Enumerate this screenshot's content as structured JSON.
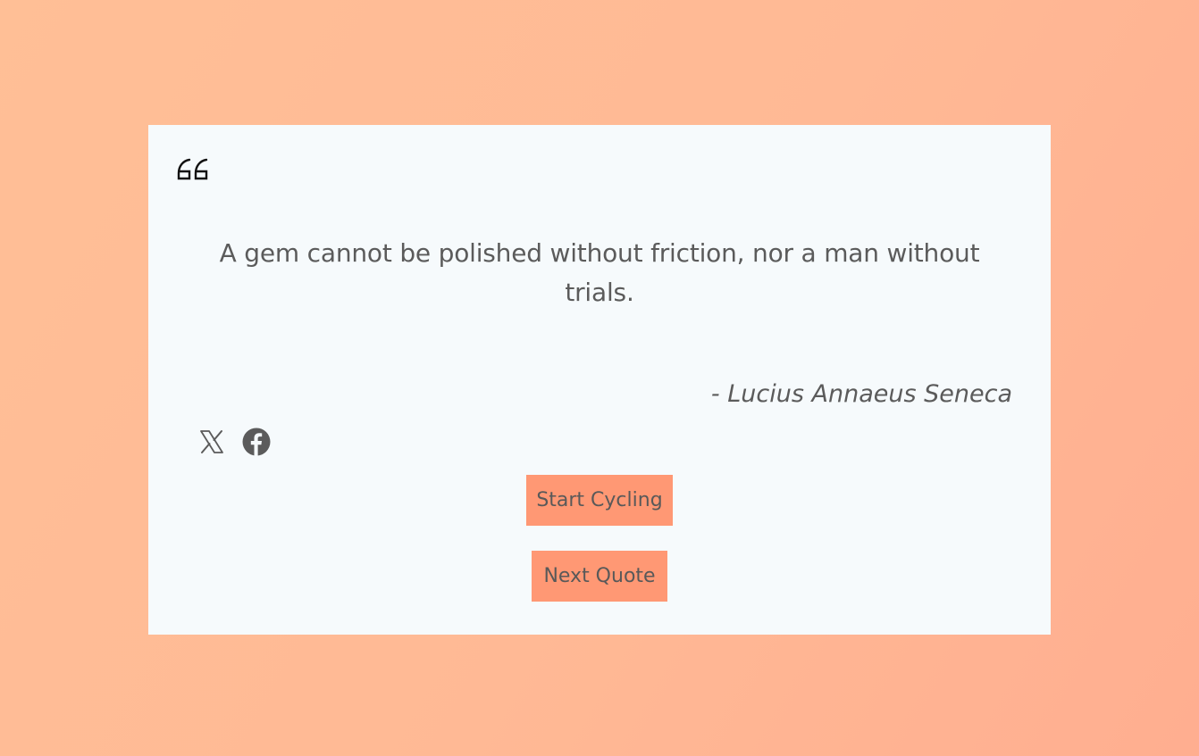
{
  "quote": {
    "text": "A gem cannot be polished without friction, nor a man without trials.",
    "author": "- Lucius Annaeus Seneca"
  },
  "icons": {
    "quote_mark": "quote-left-icon",
    "share_x": "x-logo-icon",
    "share_facebook": "facebook-logo-icon"
  },
  "buttons": {
    "start_label": "Start Cycling",
    "next_label": "Next Quote"
  },
  "colors": {
    "background_start": "#ffbf96",
    "background_end": "#ffae90",
    "card": "#f6fafc",
    "button": "#ff9874",
    "text": "#5b5b5b"
  }
}
